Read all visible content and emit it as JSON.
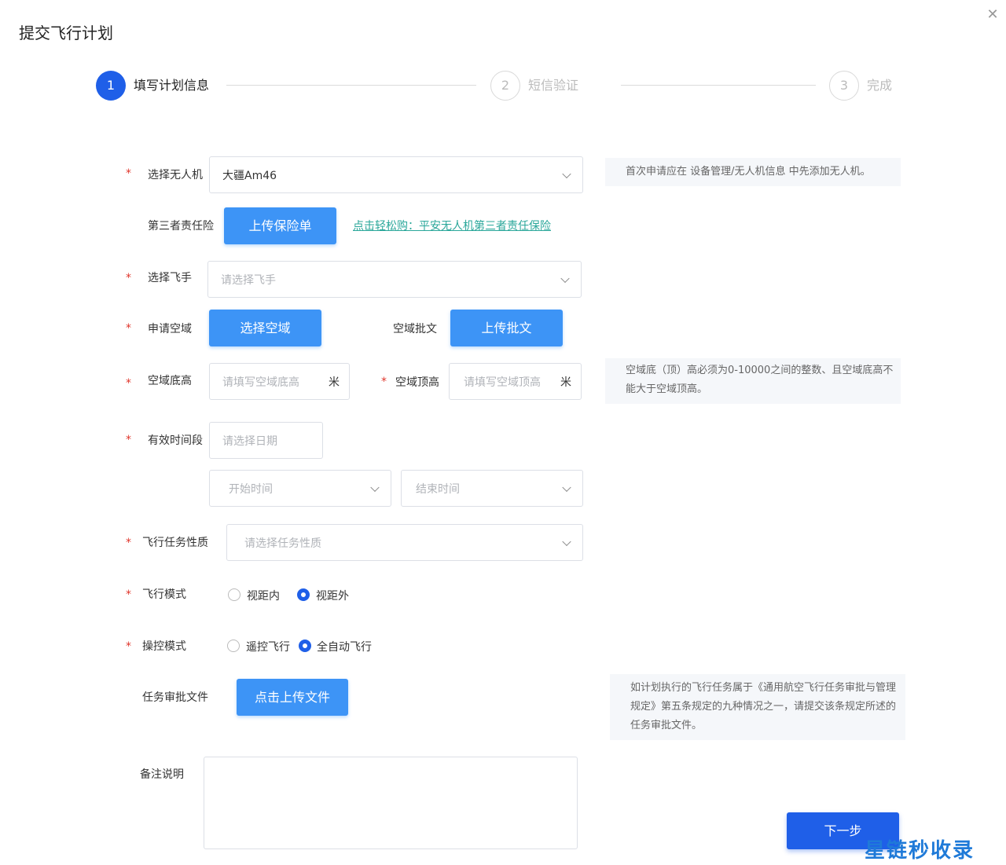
{
  "header": {
    "title": "提交飞行计划",
    "close_icon": "close-icon"
  },
  "steps": [
    {
      "number": "1",
      "label": "填写计划信息",
      "state": "active"
    },
    {
      "number": "2",
      "label": "短信验证",
      "state": "pending"
    },
    {
      "number": "3",
      "label": "完成",
      "state": "pending"
    }
  ],
  "colors": {
    "primary": "#1f5fe8",
    "button": "#3d94f6",
    "required": "#e0352b",
    "link": "#2aa79a"
  },
  "form": {
    "required_mark": "*",
    "drone": {
      "label": "选择无人机",
      "value": "大疆Am46"
    },
    "drone_note": "首次申请应在 设备管理/无人机信息 中先添加无人机。",
    "insurance": {
      "label": "第三者责任险",
      "button": "上传保险单",
      "link": "点击轻松购：平安无人机第三者责任保险"
    },
    "pilot": {
      "label": "选择飞手",
      "placeholder": "请选择飞手"
    },
    "airspace": {
      "label": "申请空域",
      "button": "选择空域",
      "approval_label": "空域批文",
      "approval_button": "上传批文"
    },
    "altitude_bottom": {
      "label": "空域底高",
      "placeholder": "请填写空域底高",
      "unit": "米"
    },
    "altitude_top": {
      "label": "空域顶高",
      "placeholder": "请填写空域顶高",
      "unit": "米"
    },
    "altitude_note": "空域底（顶）高必须为0-10000之间的整数、且空域底高不能大于空域顶高。",
    "period": {
      "label": "有效时间段",
      "date_placeholder": "请选择日期",
      "start_placeholder": "开始时间",
      "end_placeholder": "结束时间"
    },
    "task_type": {
      "label": "飞行任务性质",
      "placeholder": "请选择任务性质"
    },
    "flight_mode": {
      "label": "飞行模式",
      "options": [
        "视距内",
        "视距外"
      ],
      "selected": "视距外"
    },
    "control_mode": {
      "label": "操控模式",
      "options": [
        "遥控飞行",
        "全自动飞行"
      ],
      "selected": "全自动飞行"
    },
    "task_file": {
      "label": "任务审批文件",
      "button": "点击上传文件"
    },
    "task_file_note": "如计划执行的飞行任务属于《通用航空飞行任务审批与管理规定》第五条规定的九种情况之一，请提交该条规定所述的任务审批文件。",
    "remarks": {
      "label": "备注说明"
    }
  },
  "footer": {
    "next_button": "下一步"
  },
  "watermark": "星链秒收录"
}
